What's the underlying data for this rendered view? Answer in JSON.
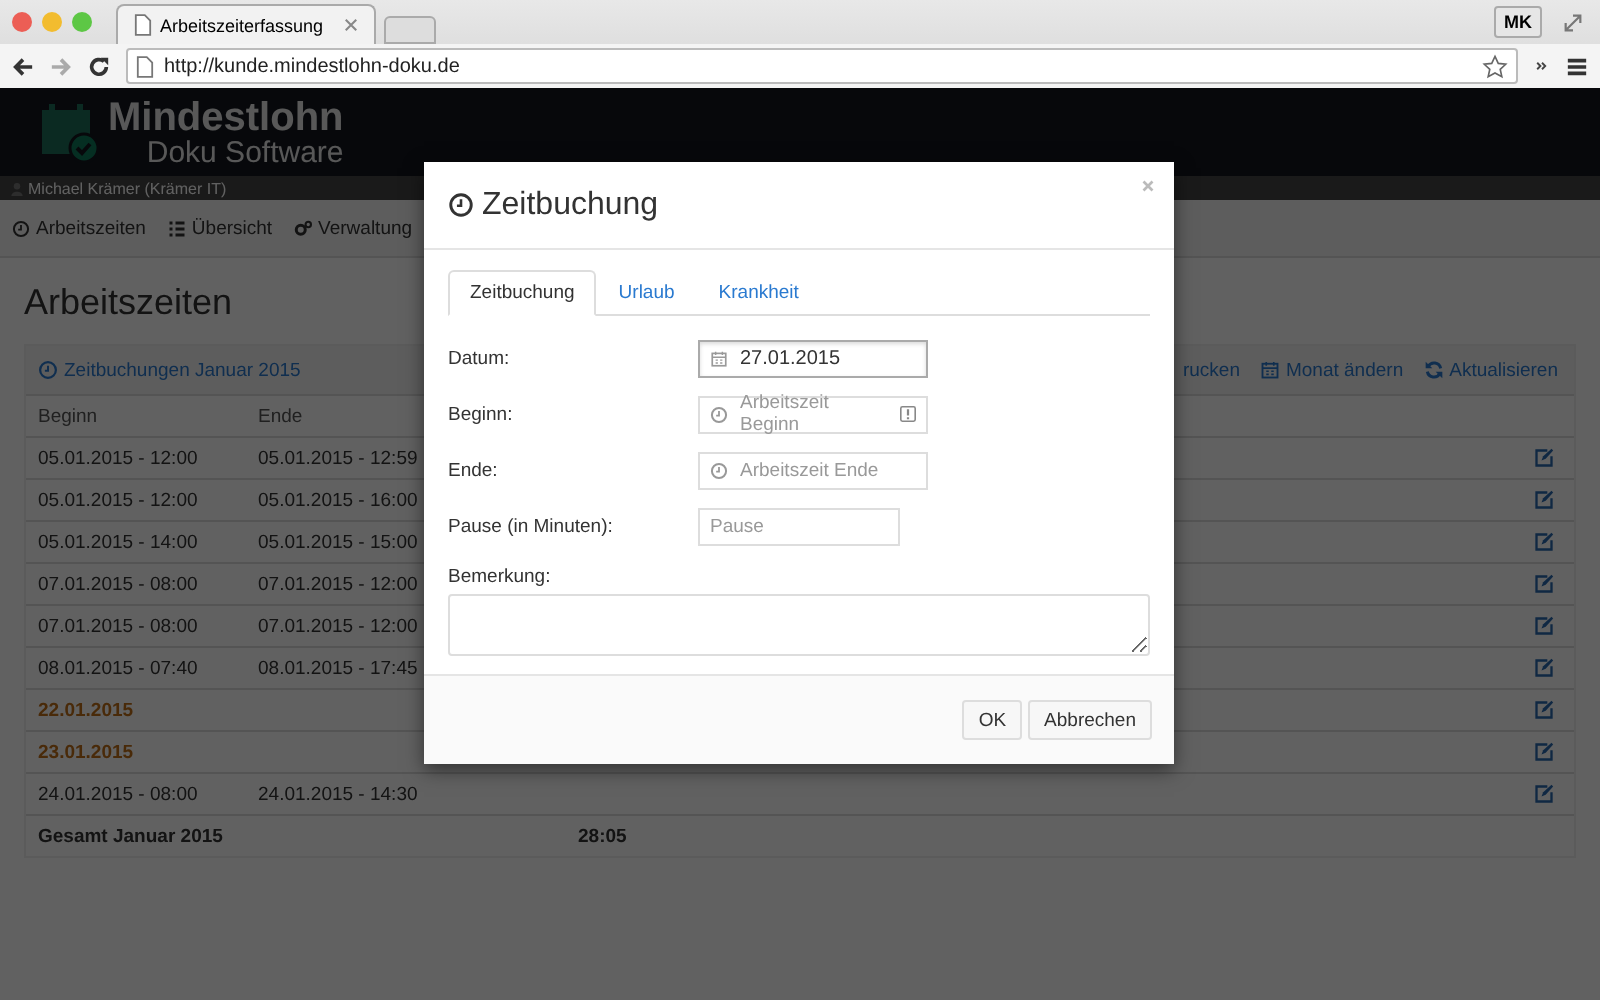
{
  "browser": {
    "tab_title": "Arbeitszeiterfassung",
    "url": "http://kunde.mindestlohn-doku.de",
    "profile": "MK"
  },
  "app": {
    "logo_title": "Mindestlohn",
    "logo_subtitle": "Doku Software",
    "user": "Michael Krämer (Krämer IT)",
    "nav": [
      {
        "label": "Arbeitszeiten"
      },
      {
        "label": "Übersicht"
      },
      {
        "label": "Verwaltung"
      }
    ],
    "page_title": "Arbeitszeiten",
    "panel_title": "Zeitbuchungen Januar 2015",
    "actions": [
      {
        "label": "rucken"
      },
      {
        "label": "Monat ändern"
      },
      {
        "label": "Aktualisieren"
      }
    ],
    "table": {
      "columns": [
        "Beginn",
        "Ende"
      ],
      "rows": [
        {
          "kind": "time",
          "beginn": "05.01.2015 - 12:00",
          "ende": "05.01.2015 - 12:59"
        },
        {
          "kind": "time",
          "beginn": "05.01.2015 - 12:00",
          "ende": "05.01.2015 - 16:00"
        },
        {
          "kind": "time",
          "beginn": "05.01.2015 - 14:00",
          "ende": "05.01.2015 - 15:00"
        },
        {
          "kind": "time",
          "beginn": "07.01.2015 - 08:00",
          "ende": "07.01.2015 - 12:00"
        },
        {
          "kind": "time",
          "beginn": "07.01.2015 - 08:00",
          "ende": "07.01.2015 - 12:00"
        },
        {
          "kind": "time",
          "beginn": "08.01.2015 - 07:40",
          "ende": "08.01.2015 - 17:45"
        },
        {
          "kind": "absence",
          "beginn": "22.01.2015",
          "ende": ""
        },
        {
          "kind": "absence",
          "beginn": "23.01.2015",
          "ende": ""
        },
        {
          "kind": "time",
          "beginn": "24.01.2015 - 08:00",
          "ende": "24.01.2015 - 14:30"
        }
      ],
      "total_label": "Gesamt Januar 2015",
      "total_value": "28:05"
    }
  },
  "dialog": {
    "title": "Zeitbuchung",
    "tabs": [
      {
        "label": "Zeitbuchung",
        "selected": true
      },
      {
        "label": "Urlaub",
        "selected": false
      },
      {
        "label": "Krankheit",
        "selected": false
      }
    ],
    "fields": [
      {
        "kind": "date",
        "label": "Datum:",
        "value": "27.01.2015"
      },
      {
        "kind": "time",
        "label": "Beginn:",
        "placeholder": "Arbeitszeit Beginn",
        "warning": true
      },
      {
        "kind": "time",
        "label": "Ende:",
        "placeholder": "Arbeitszeit Ende",
        "warning": false
      },
      {
        "kind": "number",
        "label": "Pause (in Minuten):",
        "placeholder": "Pause"
      }
    ],
    "remark_label": "Bemerkung:",
    "buttons": [
      "OK",
      "Abbrechen"
    ]
  }
}
